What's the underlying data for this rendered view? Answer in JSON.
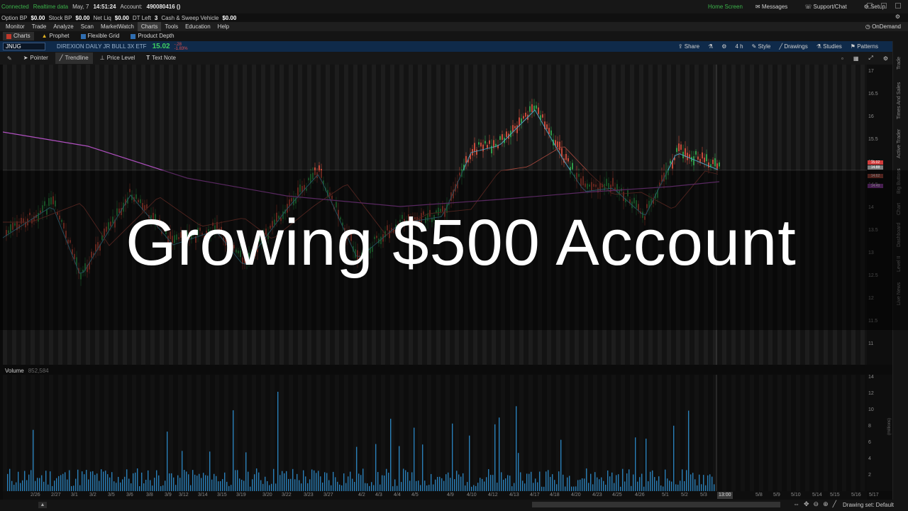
{
  "status_bar": {
    "connected": "Connected",
    "realtime": "Realtime data",
    "date": "May, 7",
    "time": "14:51:24",
    "account_label": "Account:",
    "account_value": "490080416 ()",
    "home_screen": "Home Screen",
    "messages": "Messages",
    "support": "Support/Chat",
    "setup": "Setup"
  },
  "bp_bar": {
    "option_bp_label": "Option BP",
    "option_bp_value": "$0.00",
    "stock_bp_label": "Stock BP",
    "stock_bp_value": "$0.00",
    "net_liq_label": "Net Liq",
    "net_liq_value": "$0.00",
    "dt_left_label": "DT Left",
    "dt_left_value": "3",
    "cash_label": "Cash & Sweep Vehicle",
    "cash_value": "$0.00"
  },
  "menu": {
    "items": [
      "Monitor",
      "Trade",
      "Analyze",
      "Scan",
      "MarketWatch",
      "Charts",
      "Tools",
      "Education",
      "Help"
    ],
    "active": "Charts",
    "on_demand": "OnDemand"
  },
  "subtabs": {
    "items": [
      "Charts",
      "Prophet",
      "Flexible Grid",
      "Product Depth"
    ]
  },
  "symbol": {
    "ticker": "JNUG",
    "description": "DIREXION DAILY JR BULL 3X ETF",
    "price": "15.02",
    "change_top": "-.28",
    "change_bottom": "-1.83%",
    "tools": [
      "Share",
      "4 h",
      "Style",
      "Drawings",
      "Studies",
      "Patterns"
    ]
  },
  "toolbar": {
    "pointer": "Pointer",
    "trendline": "Trendline",
    "price_level": "Price Level",
    "text_note": "Text Note"
  },
  "right_rail": [
    "Trade",
    "Times And Sales",
    "Active Trader",
    "Big Buttons",
    "Chart",
    "Dashboard",
    "Level II",
    "Live News"
  ],
  "price_axis": {
    "ticks": [
      "17",
      "16.5",
      "16",
      "15.5",
      "15",
      "14.5",
      "14",
      "13.5",
      "13",
      "12.5",
      "12",
      "11.5",
      "11"
    ],
    "tags": [
      {
        "text": "15.02",
        "color": "#d23c3c"
      },
      {
        "text": "14.88",
        "color": "#808080"
      },
      {
        "text": "14.62",
        "color": "#a0463c"
      },
      {
        "text": "14.49",
        "color": "#8c3ca0"
      }
    ]
  },
  "volume": {
    "label": "Volume",
    "value": "852,584",
    "ticks": [
      "14",
      "12",
      "10",
      "8",
      "6",
      "4",
      "2"
    ],
    "unit": "(millions)"
  },
  "date_axis": {
    "ticks": [
      "2/26",
      "2/27",
      "3/1",
      "3/2",
      "3/5",
      "3/6",
      "3/8",
      "3/9",
      "3/12",
      "3/14",
      "3/15",
      "3/19",
      "3/20",
      "3/22",
      "3/23",
      "3/27",
      "4/2",
      "4/3",
      "4/4",
      "4/5",
      "4/9",
      "4/10",
      "4/12",
      "4/13",
      "4/17",
      "4/18",
      "4/20",
      "4/23",
      "4/25",
      "4/26",
      "5/1",
      "5/2",
      "5/3",
      "5/4",
      "5/8",
      "5/9",
      "5/10",
      "5/14",
      "5/15",
      "5/16",
      "5/17"
    ],
    "cursor": "13:00"
  },
  "bottom": {
    "drawing_set": "Drawing set: Default"
  },
  "overlay": {
    "title": "Growing $500 Account"
  }
}
